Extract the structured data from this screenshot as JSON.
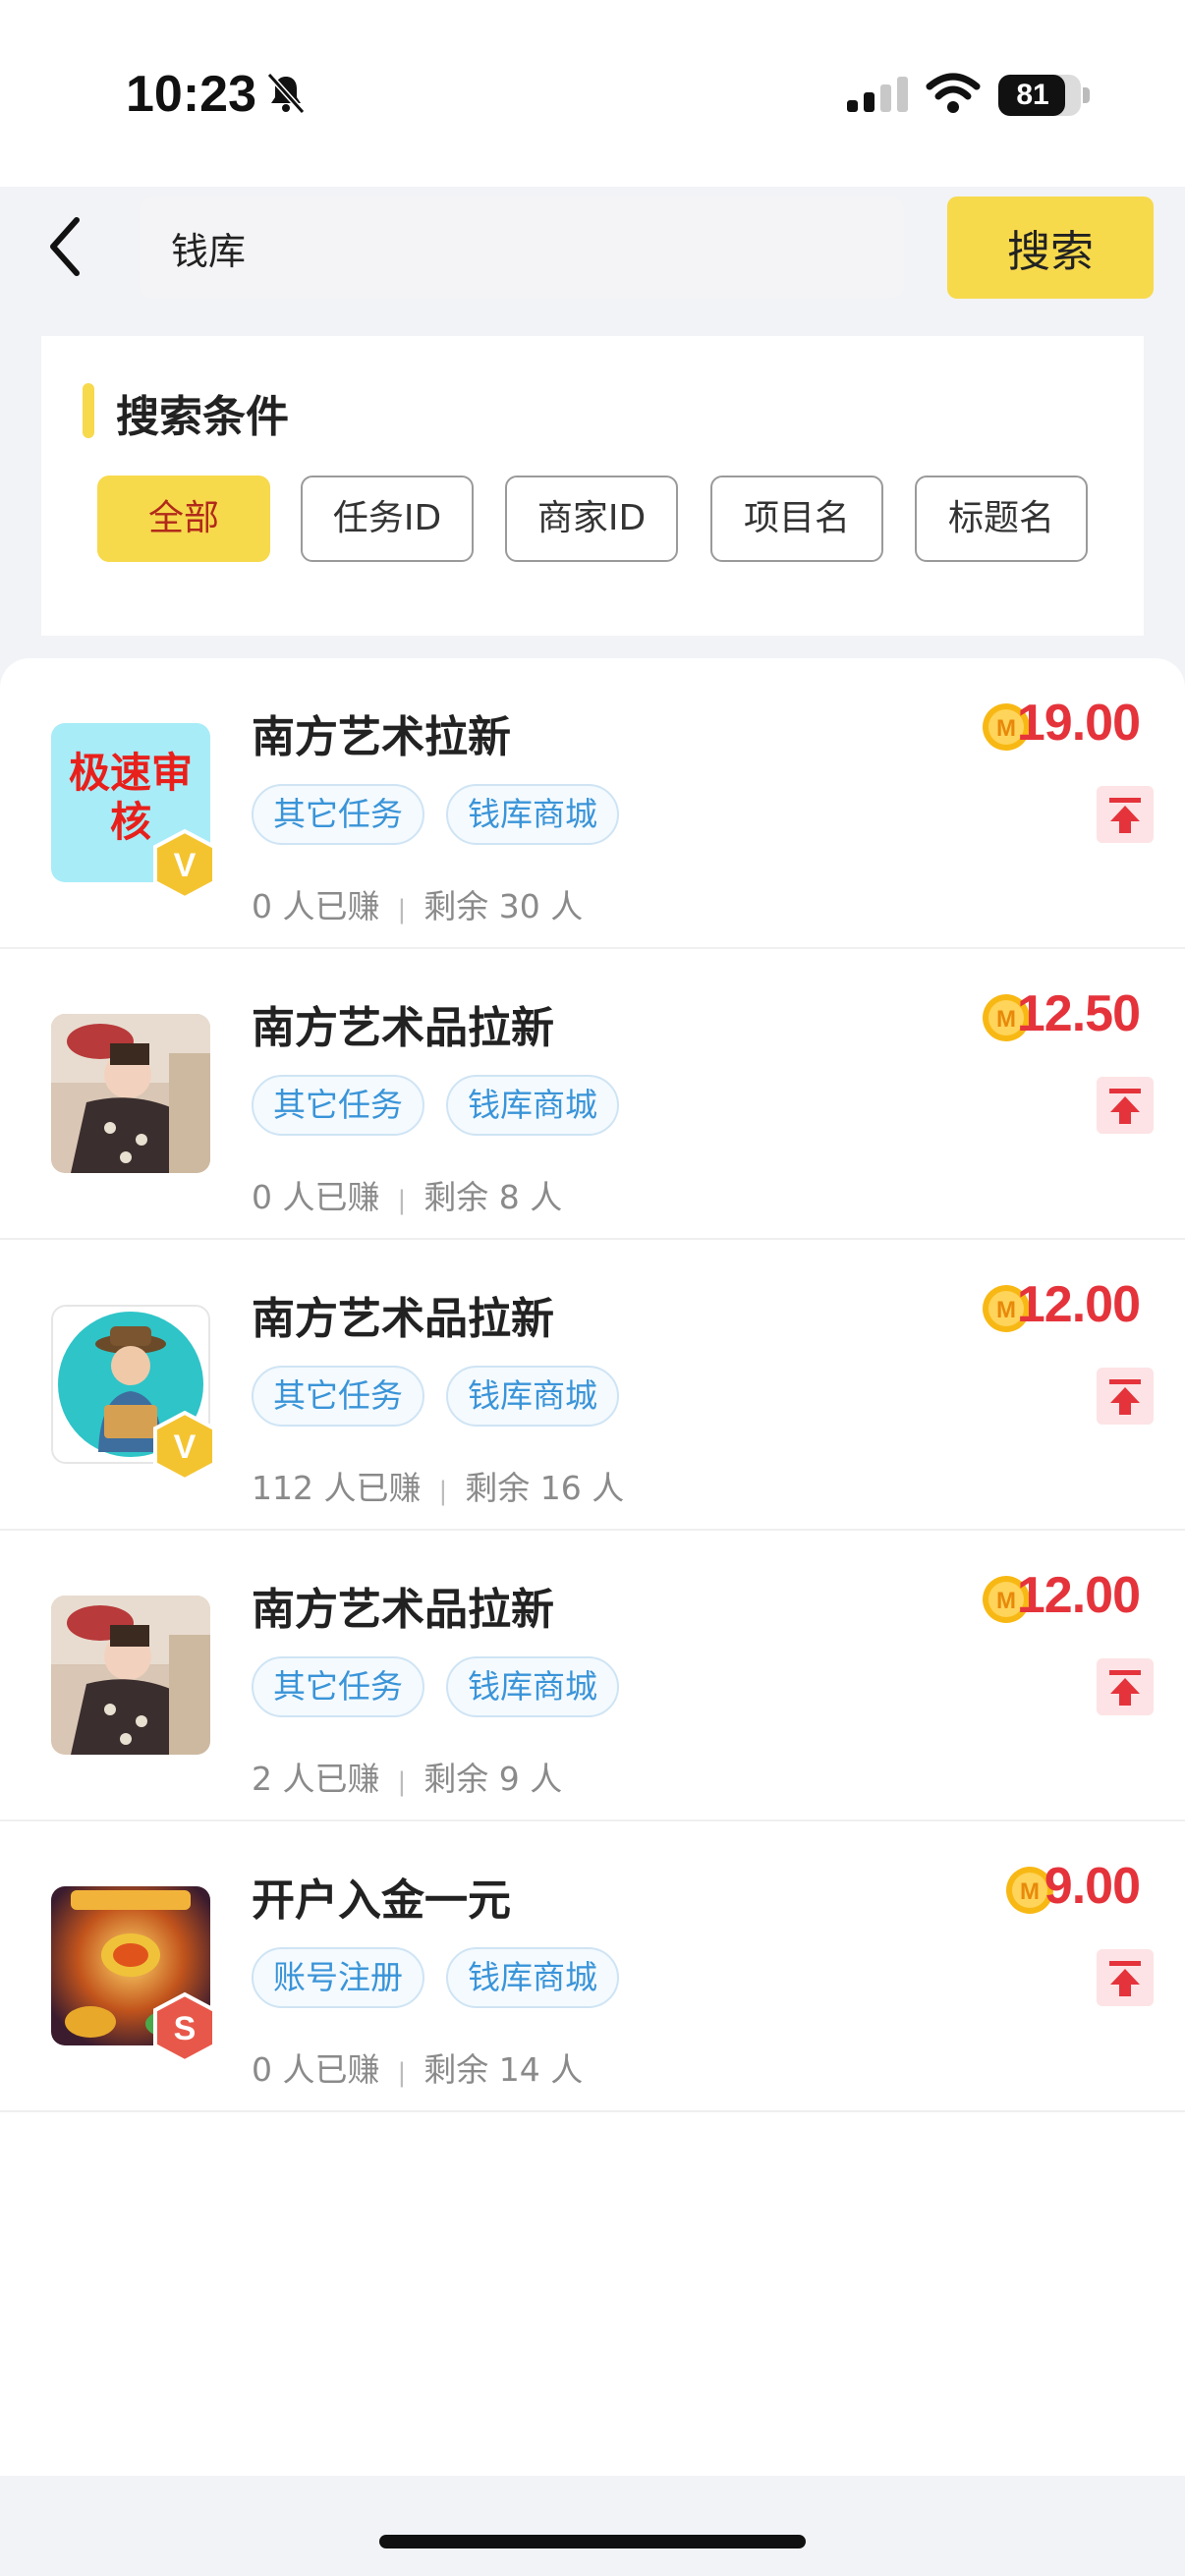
{
  "status_bar": {
    "time": "10:23",
    "battery": "81"
  },
  "search": {
    "value": "钱库",
    "button_label": "搜索"
  },
  "filter": {
    "title": "搜索条件",
    "options": [
      "全部",
      "任务ID",
      "商家ID",
      "项目名",
      "标题名"
    ],
    "selected": "全部"
  },
  "tasks": [
    {
      "title": "南方艺术拉新",
      "tags": [
        "其它任务",
        "钱库商城"
      ],
      "earned": "0 人已赚",
      "remaining": "剩余 30 人",
      "price": "19.00",
      "thumb_text": "极速审核",
      "badge": "V"
    },
    {
      "title": "南方艺术品拉新",
      "tags": [
        "其它任务",
        "钱库商城"
      ],
      "earned": "0 人已赚",
      "remaining": "剩余 8 人",
      "price": "12.50",
      "badge": ""
    },
    {
      "title": "南方艺术品拉新",
      "tags": [
        "其它任务",
        "钱库商城"
      ],
      "earned": "112 人已赚",
      "remaining": "剩余 16 人",
      "price": "12.00",
      "badge": "V"
    },
    {
      "title": "南方艺术品拉新",
      "tags": [
        "其它任务",
        "钱库商城"
      ],
      "earned": "2 人已赚",
      "remaining": "剩余 9 人",
      "price": "12.00",
      "badge": ""
    },
    {
      "title": "开户入金一元",
      "tags": [
        "账号注册",
        "钱库商城"
      ],
      "earned": "0 人已赚",
      "remaining": "剩余 14 人",
      "price": "9.00",
      "badge": "S"
    }
  ],
  "colors": {
    "accent": "#f7d94c",
    "price": "#e5333b",
    "tag": "#3a94d8"
  }
}
